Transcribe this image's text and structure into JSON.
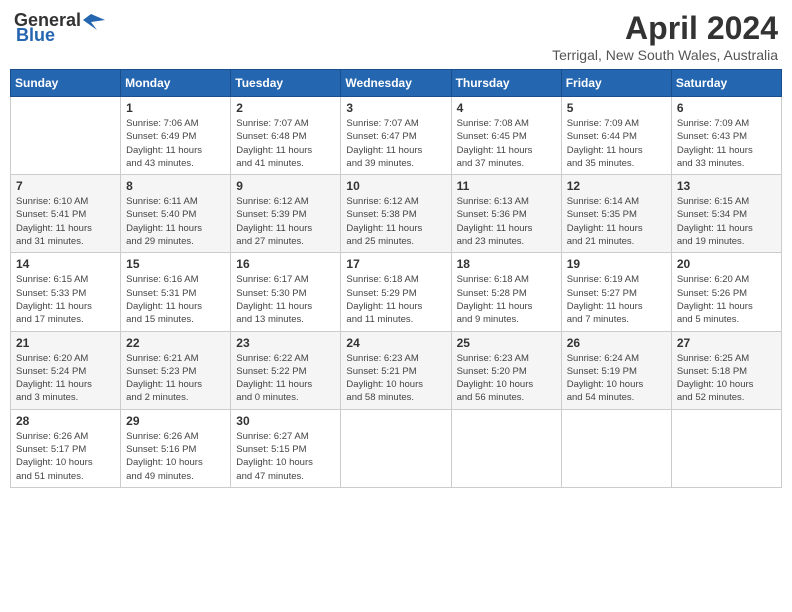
{
  "header": {
    "logo_general": "General",
    "logo_blue": "Blue",
    "month_year": "April 2024",
    "location": "Terrigal, New South Wales, Australia"
  },
  "days_of_week": [
    "Sunday",
    "Monday",
    "Tuesday",
    "Wednesday",
    "Thursday",
    "Friday",
    "Saturday"
  ],
  "weeks": [
    [
      {
        "day": "",
        "info": ""
      },
      {
        "day": "1",
        "info": "Sunrise: 7:06 AM\nSunset: 6:49 PM\nDaylight: 11 hours\nand 43 minutes."
      },
      {
        "day": "2",
        "info": "Sunrise: 7:07 AM\nSunset: 6:48 PM\nDaylight: 11 hours\nand 41 minutes."
      },
      {
        "day": "3",
        "info": "Sunrise: 7:07 AM\nSunset: 6:47 PM\nDaylight: 11 hours\nand 39 minutes."
      },
      {
        "day": "4",
        "info": "Sunrise: 7:08 AM\nSunset: 6:45 PM\nDaylight: 11 hours\nand 37 minutes."
      },
      {
        "day": "5",
        "info": "Sunrise: 7:09 AM\nSunset: 6:44 PM\nDaylight: 11 hours\nand 35 minutes."
      },
      {
        "day": "6",
        "info": "Sunrise: 7:09 AM\nSunset: 6:43 PM\nDaylight: 11 hours\nand 33 minutes."
      }
    ],
    [
      {
        "day": "7",
        "info": "Sunrise: 6:10 AM\nSunset: 5:41 PM\nDaylight: 11 hours\nand 31 minutes."
      },
      {
        "day": "8",
        "info": "Sunrise: 6:11 AM\nSunset: 5:40 PM\nDaylight: 11 hours\nand 29 minutes."
      },
      {
        "day": "9",
        "info": "Sunrise: 6:12 AM\nSunset: 5:39 PM\nDaylight: 11 hours\nand 27 minutes."
      },
      {
        "day": "10",
        "info": "Sunrise: 6:12 AM\nSunset: 5:38 PM\nDaylight: 11 hours\nand 25 minutes."
      },
      {
        "day": "11",
        "info": "Sunrise: 6:13 AM\nSunset: 5:36 PM\nDaylight: 11 hours\nand 23 minutes."
      },
      {
        "day": "12",
        "info": "Sunrise: 6:14 AM\nSunset: 5:35 PM\nDaylight: 11 hours\nand 21 minutes."
      },
      {
        "day": "13",
        "info": "Sunrise: 6:15 AM\nSunset: 5:34 PM\nDaylight: 11 hours\nand 19 minutes."
      }
    ],
    [
      {
        "day": "14",
        "info": "Sunrise: 6:15 AM\nSunset: 5:33 PM\nDaylight: 11 hours\nand 17 minutes."
      },
      {
        "day": "15",
        "info": "Sunrise: 6:16 AM\nSunset: 5:31 PM\nDaylight: 11 hours\nand 15 minutes."
      },
      {
        "day": "16",
        "info": "Sunrise: 6:17 AM\nSunset: 5:30 PM\nDaylight: 11 hours\nand 13 minutes."
      },
      {
        "day": "17",
        "info": "Sunrise: 6:18 AM\nSunset: 5:29 PM\nDaylight: 11 hours\nand 11 minutes."
      },
      {
        "day": "18",
        "info": "Sunrise: 6:18 AM\nSunset: 5:28 PM\nDaylight: 11 hours\nand 9 minutes."
      },
      {
        "day": "19",
        "info": "Sunrise: 6:19 AM\nSunset: 5:27 PM\nDaylight: 11 hours\nand 7 minutes."
      },
      {
        "day": "20",
        "info": "Sunrise: 6:20 AM\nSunset: 5:26 PM\nDaylight: 11 hours\nand 5 minutes."
      }
    ],
    [
      {
        "day": "21",
        "info": "Sunrise: 6:20 AM\nSunset: 5:24 PM\nDaylight: 11 hours\nand 3 minutes."
      },
      {
        "day": "22",
        "info": "Sunrise: 6:21 AM\nSunset: 5:23 PM\nDaylight: 11 hours\nand 2 minutes."
      },
      {
        "day": "23",
        "info": "Sunrise: 6:22 AM\nSunset: 5:22 PM\nDaylight: 11 hours\nand 0 minutes."
      },
      {
        "day": "24",
        "info": "Sunrise: 6:23 AM\nSunset: 5:21 PM\nDaylight: 10 hours\nand 58 minutes."
      },
      {
        "day": "25",
        "info": "Sunrise: 6:23 AM\nSunset: 5:20 PM\nDaylight: 10 hours\nand 56 minutes."
      },
      {
        "day": "26",
        "info": "Sunrise: 6:24 AM\nSunset: 5:19 PM\nDaylight: 10 hours\nand 54 minutes."
      },
      {
        "day": "27",
        "info": "Sunrise: 6:25 AM\nSunset: 5:18 PM\nDaylight: 10 hours\nand 52 minutes."
      }
    ],
    [
      {
        "day": "28",
        "info": "Sunrise: 6:26 AM\nSunset: 5:17 PM\nDaylight: 10 hours\nand 51 minutes."
      },
      {
        "day": "29",
        "info": "Sunrise: 6:26 AM\nSunset: 5:16 PM\nDaylight: 10 hours\nand 49 minutes."
      },
      {
        "day": "30",
        "info": "Sunrise: 6:27 AM\nSunset: 5:15 PM\nDaylight: 10 hours\nand 47 minutes."
      },
      {
        "day": "",
        "info": ""
      },
      {
        "day": "",
        "info": ""
      },
      {
        "day": "",
        "info": ""
      },
      {
        "day": "",
        "info": ""
      }
    ]
  ]
}
